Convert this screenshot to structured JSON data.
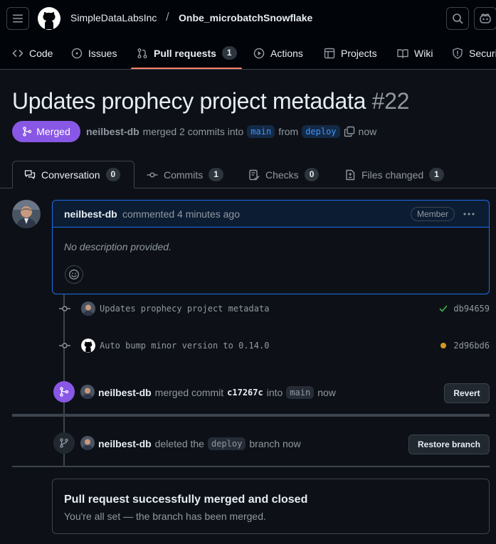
{
  "header": {
    "org": "SimpleDataLabsInc",
    "separator": "/",
    "repo": "Onbe_microbatchSnowflake"
  },
  "repo_nav": {
    "items": [
      {
        "label": "Code",
        "icon": "code-icon"
      },
      {
        "label": "Issues",
        "icon": "issue-icon"
      },
      {
        "label": "Pull requests",
        "icon": "pull-request-icon",
        "count": "1",
        "active": true
      },
      {
        "label": "Actions",
        "icon": "play-icon"
      },
      {
        "label": "Projects",
        "icon": "table-icon"
      },
      {
        "label": "Wiki",
        "icon": "book-icon"
      },
      {
        "label": "Security",
        "icon": "shield-icon"
      }
    ]
  },
  "pr": {
    "title": "Updates prophecy project metadata",
    "number": "#22",
    "state": "Merged",
    "author": "neilbest-db",
    "merged_text": "merged 2 commits into",
    "base_branch": "main",
    "from_text": "from",
    "head_branch": "deploy",
    "time": "now"
  },
  "tabs": [
    {
      "label": "Conversation",
      "count": "0",
      "icon": "comment-discussion-icon",
      "active": true
    },
    {
      "label": "Commits",
      "count": "1",
      "icon": "commit-icon"
    },
    {
      "label": "Checks",
      "count": "0",
      "icon": "checklist-icon"
    },
    {
      "label": "Files changed",
      "count": "1",
      "icon": "file-diff-icon"
    }
  ],
  "comment": {
    "author": "neilbest-db",
    "meta": "commented 4 minutes ago",
    "role": "Member",
    "body": "No description provided."
  },
  "commits": [
    {
      "message": "Updates prophecy project metadata",
      "sha": "db94659",
      "status": "success",
      "status_color": "#3fb950"
    },
    {
      "message": "Auto bump minor version to 0.14.0",
      "sha": "2d96bd6",
      "status": "pending",
      "status_color": "#d29922"
    }
  ],
  "merge_event": {
    "author": "neilbest-db",
    "text1": "merged commit",
    "sha": "c17267c",
    "text2": "into",
    "branch": "main",
    "time": "now",
    "button": "Revert"
  },
  "delete_event": {
    "author": "neilbest-db",
    "text1": "deleted the",
    "branch": "deploy",
    "text2": "branch now",
    "button": "Restore branch"
  },
  "merged_box": {
    "title": "Pull request successfully merged and closed",
    "subtitle": "You're all set — the branch has been merged."
  },
  "colors": {
    "accent_merged": "#8957e5",
    "underline": "#f78166",
    "link": "#4493f8"
  }
}
